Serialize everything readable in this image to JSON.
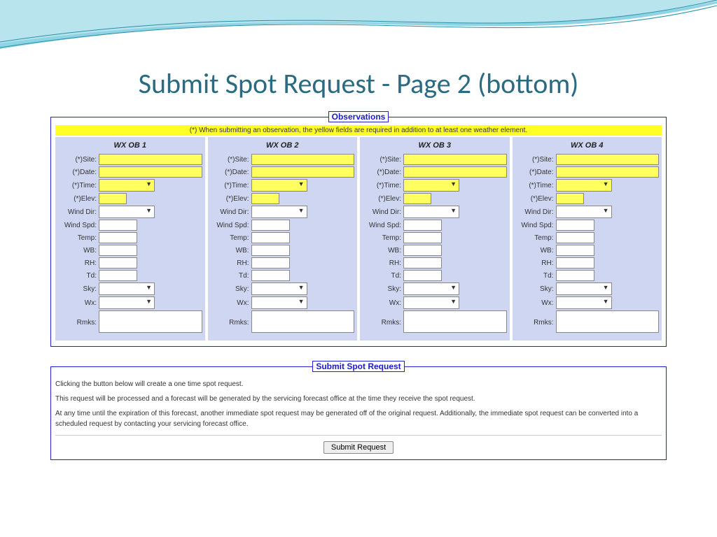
{
  "title": "Submit Spot Request - Page 2 (bottom)",
  "observations": {
    "legend": "Observations",
    "note": "(*) When submitting an observation, the yellow fields are required in addition to at least one weather element.",
    "columns": [
      "WX OB 1",
      "WX OB 2",
      "WX OB 3",
      "WX OB 4"
    ],
    "fields": {
      "site": "(*)Site:",
      "date": "(*)Date:",
      "time": "(*)Time:",
      "elev": "(*)Elev:",
      "winddir": "Wind Dir:",
      "windspd": "Wind Spd:",
      "temp": "Temp:",
      "wb": "WB:",
      "rh": "RH:",
      "td": "Td:",
      "sky": "Sky:",
      "wx": "Wx:",
      "rmks": "Rmks:"
    }
  },
  "submit": {
    "legend": "Submit Spot Request",
    "p1": "Clicking the button below will create a one time spot request.",
    "p2": "This request will be processed and a forecast will be generated by the servicing forecast office at the time they receive the spot request.",
    "p3": "At any time until the expiration of this forecast, another immediate spot request may be generated off of the original request. Additionally, the immediate spot request can be converted into a scheduled request by contacting your servicing forecast office.",
    "button": "Submit Request"
  }
}
